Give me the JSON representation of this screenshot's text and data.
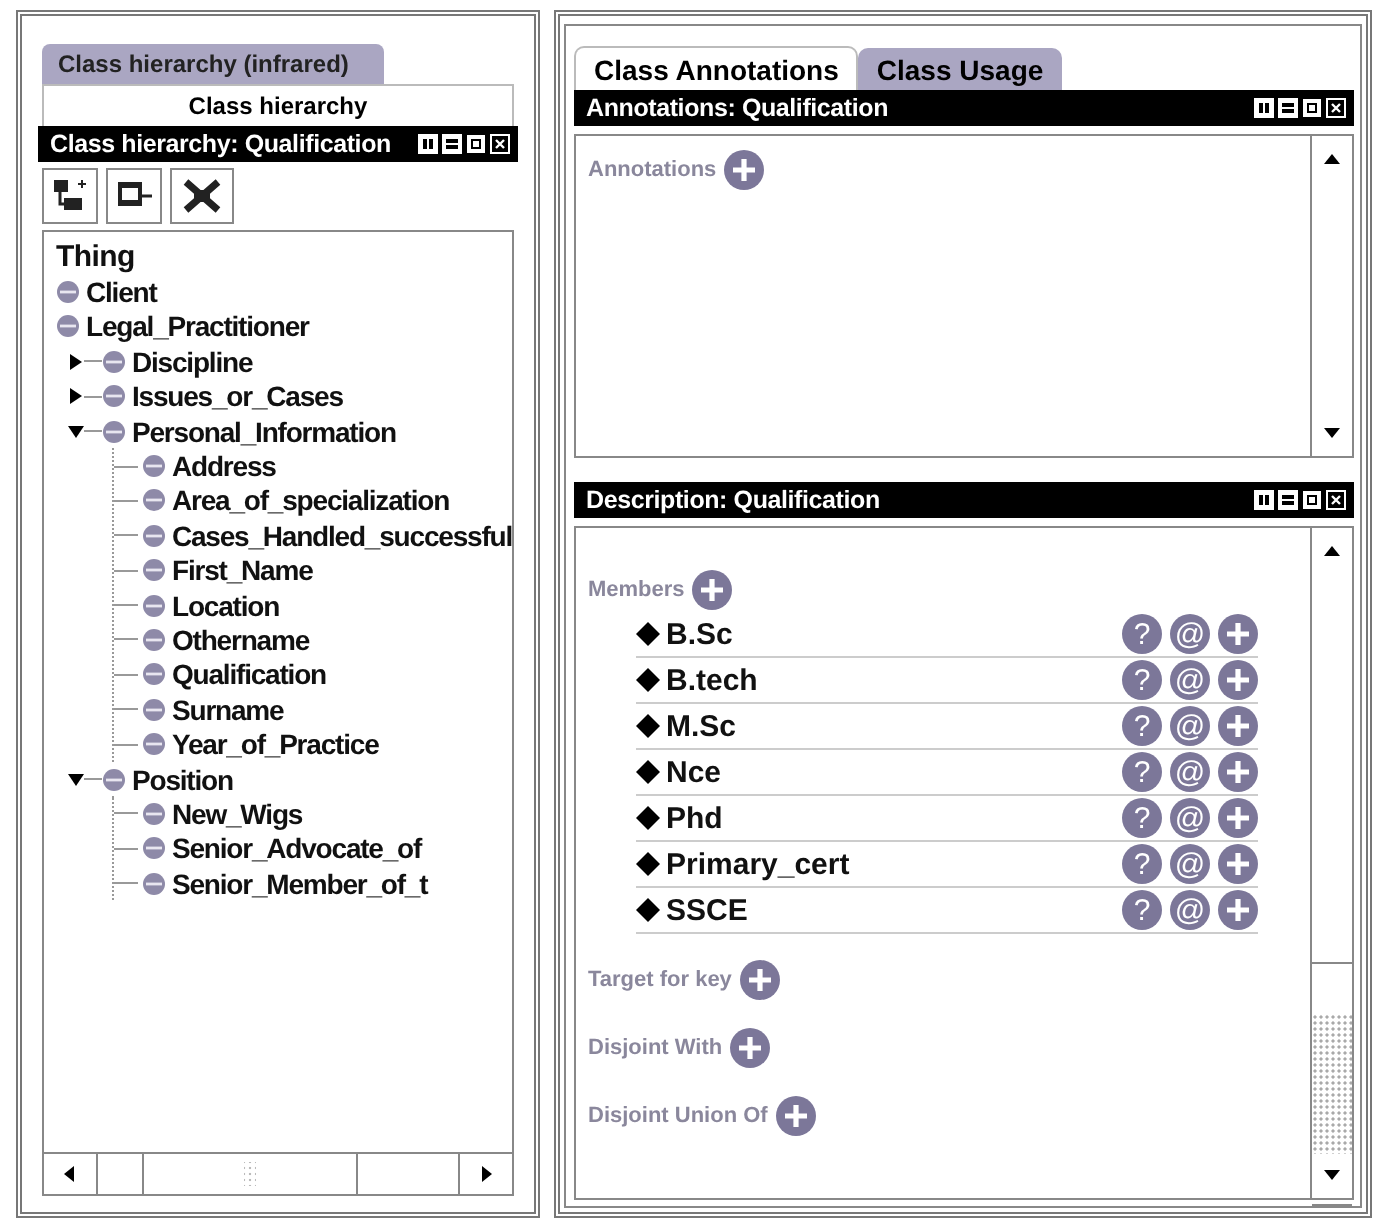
{
  "left_panel": {
    "tabs": [
      {
        "label": "Class hierarchy (infrared)",
        "selected": false
      },
      {
        "label": "Class hierarchy",
        "selected": true
      }
    ],
    "title": "Class hierarchy: Qualification",
    "tree": {
      "label": "Thing",
      "children": [
        {
          "label": "Client"
        },
        {
          "label": "Legal_Practitioner",
          "children": [
            {
              "label": "Discipline",
              "expanded": false
            },
            {
              "label": "Issues_or_Cases",
              "expanded": false
            },
            {
              "label": "Personal_Information",
              "expanded": true,
              "children": [
                {
                  "label": "Address"
                },
                {
                  "label": "Area_of_specialization"
                },
                {
                  "label": "Cases_Handled_successful"
                },
                {
                  "label": "First_Name"
                },
                {
                  "label": "Location"
                },
                {
                  "label": "Othername"
                },
                {
                  "label": "Qualification"
                },
                {
                  "label": "Surname"
                },
                {
                  "label": "Year_of_Practice"
                }
              ]
            },
            {
              "label": "Position",
              "expanded": true,
              "children": [
                {
                  "label": "New_Wigs"
                },
                {
                  "label": "Senior_Advocate_of"
                },
                {
                  "label": "Senior_Member_of_t"
                }
              ]
            }
          ]
        }
      ]
    }
  },
  "right_panel": {
    "tabs": [
      {
        "label": "Class Annotations",
        "selected": true
      },
      {
        "label": "Class Usage",
        "selected": false
      }
    ],
    "annotations": {
      "title": "Annotations: Qualification",
      "sections": [
        {
          "label": "Annotations"
        }
      ]
    },
    "description": {
      "title": "Description: Qualification",
      "sections": [
        {
          "label": "Members",
          "items": [
            {
              "label": "B.Sc",
              "actions": [
                "?",
                "@"
              ]
            },
            {
              "label": "B.tech",
              "actions": [
                "?",
                "@"
              ]
            },
            {
              "label": "M.Sc",
              "actions": [
                "?",
                "@"
              ]
            },
            {
              "label": "Nce",
              "actions": [
                "?",
                "@"
              ]
            },
            {
              "label": "Phd",
              "actions": [
                "?",
                "@"
              ]
            },
            {
              "label": "Primary_cert",
              "actions": [
                "?",
                "@"
              ]
            },
            {
              "label": "SSCE",
              "actions": [
                "?",
                "@"
              ]
            }
          ]
        },
        {
          "label": "Target for key"
        },
        {
          "label": "Disjoint With"
        },
        {
          "label": "Disjoint Union Of"
        }
      ]
    }
  }
}
